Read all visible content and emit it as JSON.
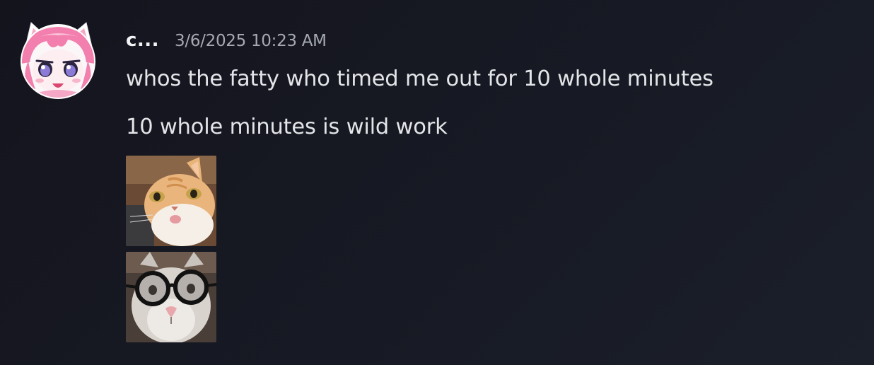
{
  "message": {
    "author": {
      "display_name": "c...",
      "avatar_icon": "anime-catgirl-avatar-icon",
      "accent_color": "#ef8fb5"
    },
    "timestamp": "3/6/2025 10:23 AM",
    "lines": [
      "whos the fatty who timed me out for 10 whole minutes",
      "10 whole minutes is wild work"
    ],
    "attachments": [
      {
        "icon": "orange-cat-sticker-icon"
      },
      {
        "icon": "glasses-cat-sticker-icon"
      }
    ]
  }
}
